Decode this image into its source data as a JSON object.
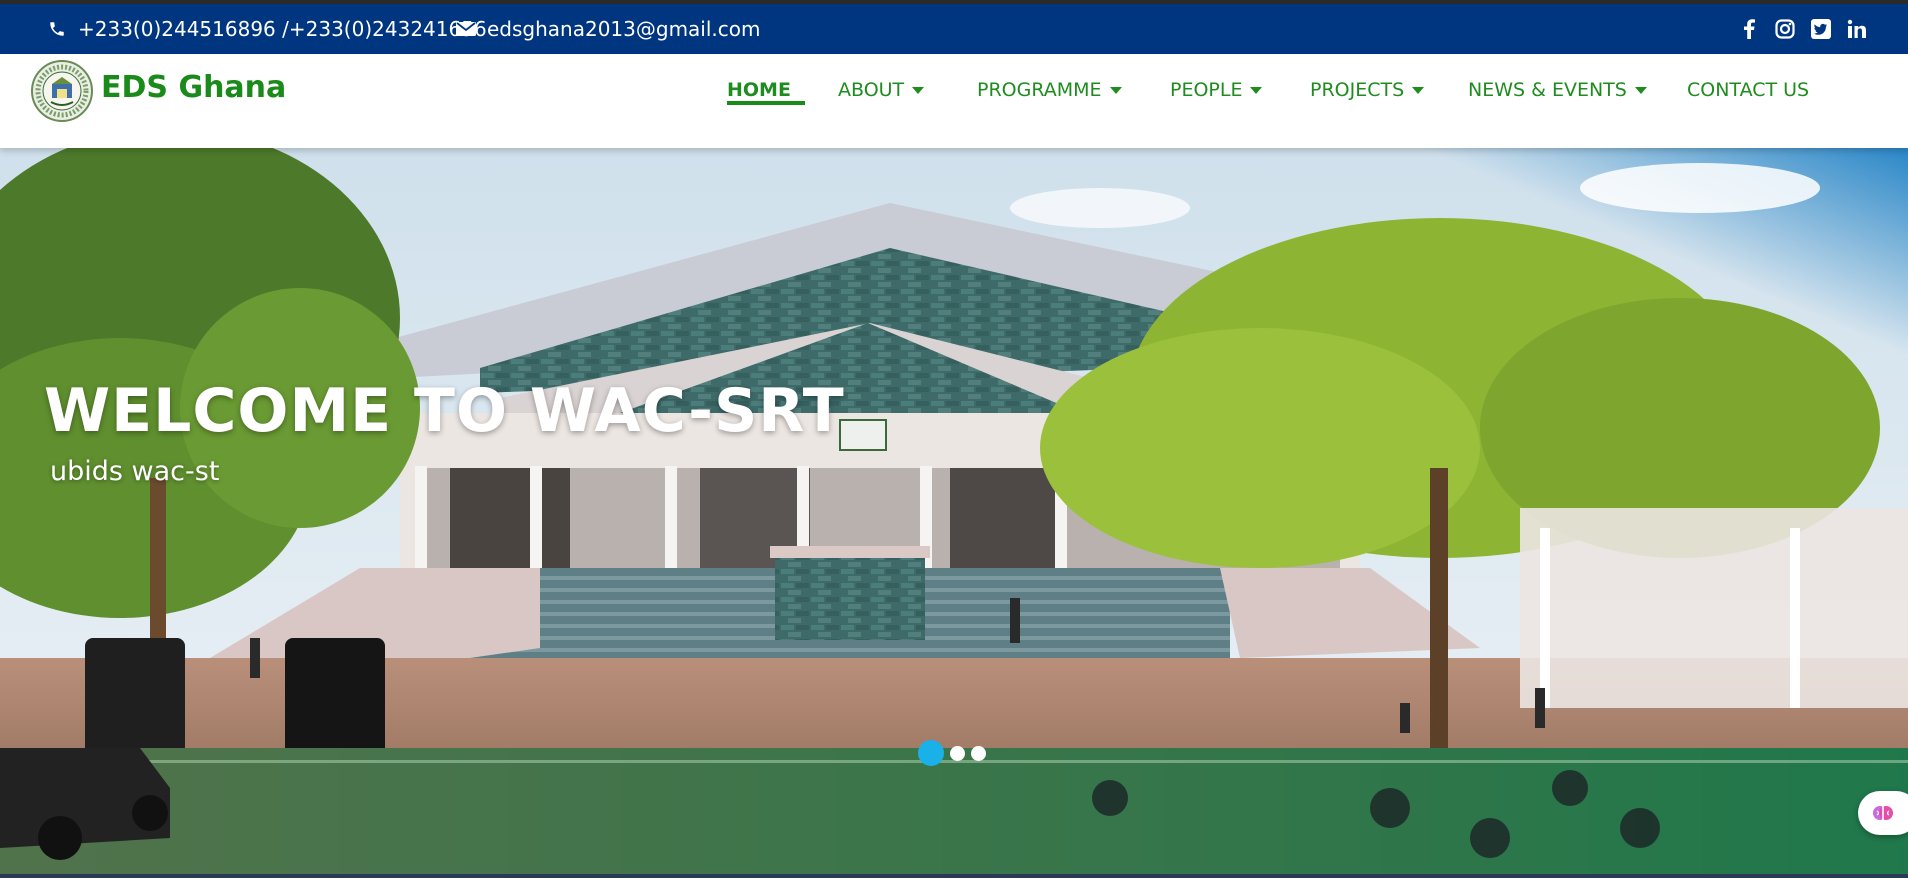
{
  "topbar": {
    "phone": "+233(0)244516896 /+233(0)243241656",
    "email": "edsghana2013@gmail.com",
    "social": [
      {
        "icon": "facebook-icon",
        "glyph": "f"
      },
      {
        "icon": "instagram-icon",
        "glyph": ""
      },
      {
        "icon": "twitter-icon",
        "glyph": ""
      },
      {
        "icon": "linkedin-icon",
        "glyph": "in"
      }
    ]
  },
  "brand": {
    "name": "EDS Ghana",
    "color": "#1a8a1a"
  },
  "nav": {
    "items": [
      {
        "label": "HOME",
        "active": true,
        "dropdown": false
      },
      {
        "label": "ABOUT",
        "active": false,
        "dropdown": true
      },
      {
        "label": "PROGRAMME",
        "active": false,
        "dropdown": true
      },
      {
        "label": "PEOPLE",
        "active": false,
        "dropdown": true
      },
      {
        "label": "PROJECTS",
        "active": false,
        "dropdown": true
      },
      {
        "label": "NEWS & EVENTS",
        "active": false,
        "dropdown": true
      },
      {
        "label": "CONTACT US",
        "active": false,
        "dropdown": false
      }
    ]
  },
  "hero": {
    "title": "WELCOME TO WAC-SRT",
    "subtitle": "ubids wac-st",
    "slides_count": 3,
    "active_slide": 1
  },
  "colors": {
    "topbar_bg": "#003580",
    "nav_text": "#1f8c1f",
    "indicator_active": "#1ab0e8"
  }
}
